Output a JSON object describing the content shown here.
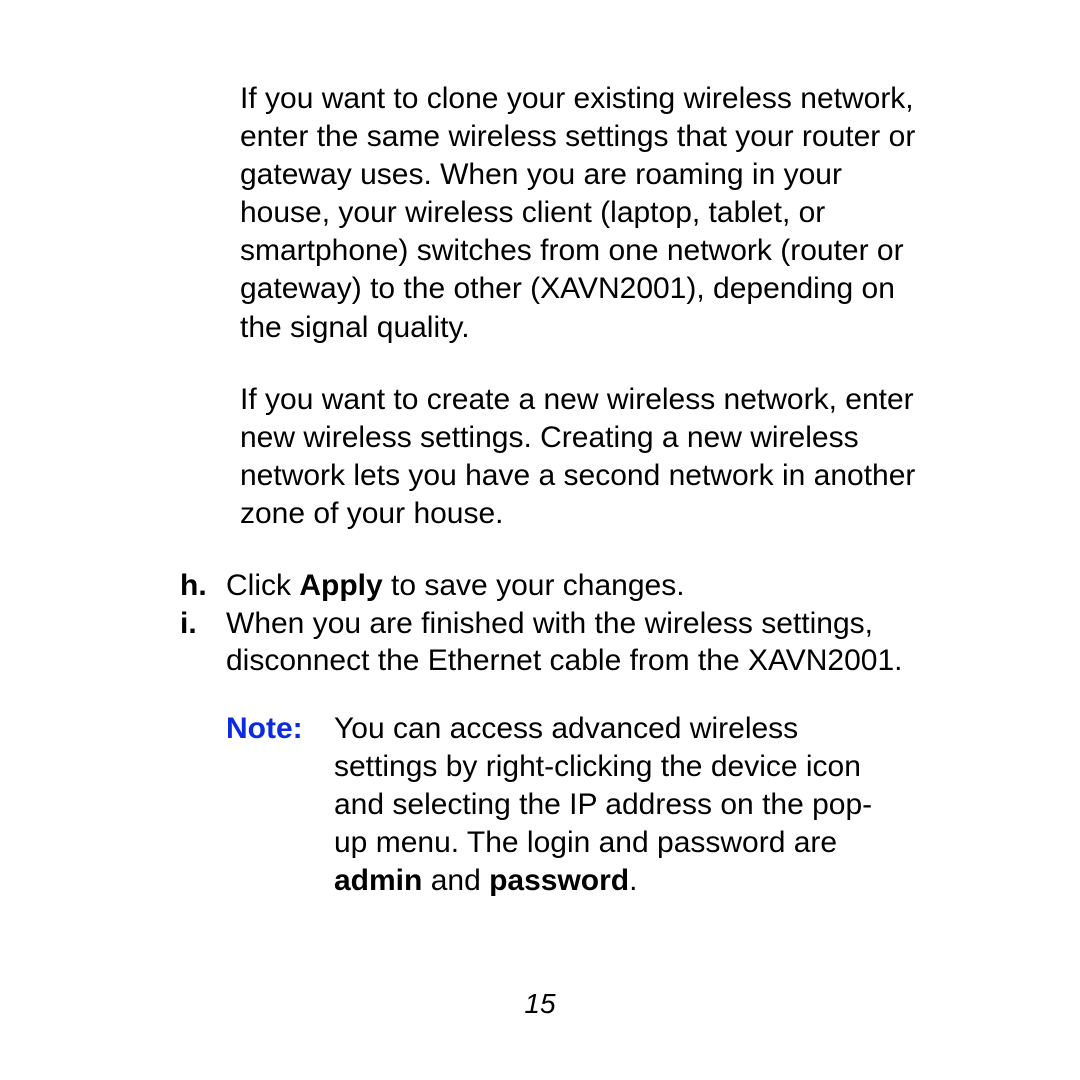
{
  "paragraphs": {
    "p1": "If you want to clone your existing wireless network, enter the same wireless settings that your router or gateway uses. When you are roaming in your house, your wireless client (laptop, tablet, or smartphone) switches from one network (router or gateway) to the other (XAVN2001), depending on the signal quality.",
    "p2": "If you want to create a new wireless network, enter new wireless settings. Creating a new wireless network lets you have a second network in another zone of your house."
  },
  "list": {
    "h": {
      "marker": "h.",
      "pre": "Click ",
      "bold": "Apply",
      "post": " to save your changes."
    },
    "i": {
      "marker": "i.",
      "text": "When you are finished with the wireless settings, disconnect the Ethernet cable from the XAVN2001."
    }
  },
  "note": {
    "label": "Note:",
    "pre": "You can access advanced wireless settings by right-clicking the device icon and selecting the IP address on the pop-up menu. The login and password are ",
    "bold1": "admin",
    "mid": " and ",
    "bold2": "password",
    "post": "."
  },
  "page_number": "15"
}
